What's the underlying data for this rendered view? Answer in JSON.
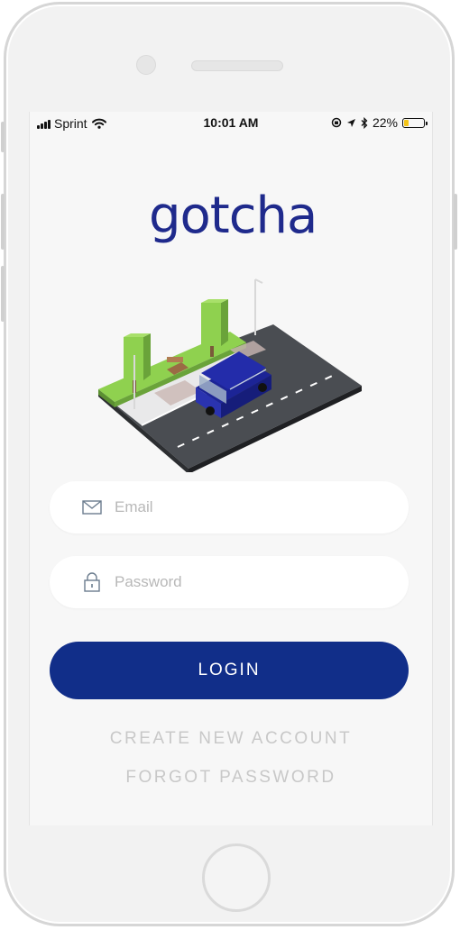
{
  "status_bar": {
    "carrier": "Sprint",
    "time": "10:01 AM",
    "battery_text": "22%",
    "battery_level": 0.22,
    "battery_color": "#f5c518",
    "icons": [
      "signal-icon",
      "wifi-icon",
      "rotation-lock-icon",
      "location-icon",
      "bluetooth-icon",
      "battery-icon"
    ]
  },
  "app": {
    "logo_text": "gotcha",
    "brand_color": "#1f2a8c",
    "illustration": "street-car-illustration"
  },
  "form": {
    "email_placeholder": "Email",
    "email_value": "",
    "email_icon": "envelope-icon",
    "password_placeholder": "Password",
    "password_value": "",
    "password_icon": "lock-icon",
    "login_label": "LOGIN",
    "login_color": "#112e89"
  },
  "links": {
    "create_account": "CREATE NEW ACCOUNT",
    "forgot_password": "FORGOT PASSWORD"
  }
}
